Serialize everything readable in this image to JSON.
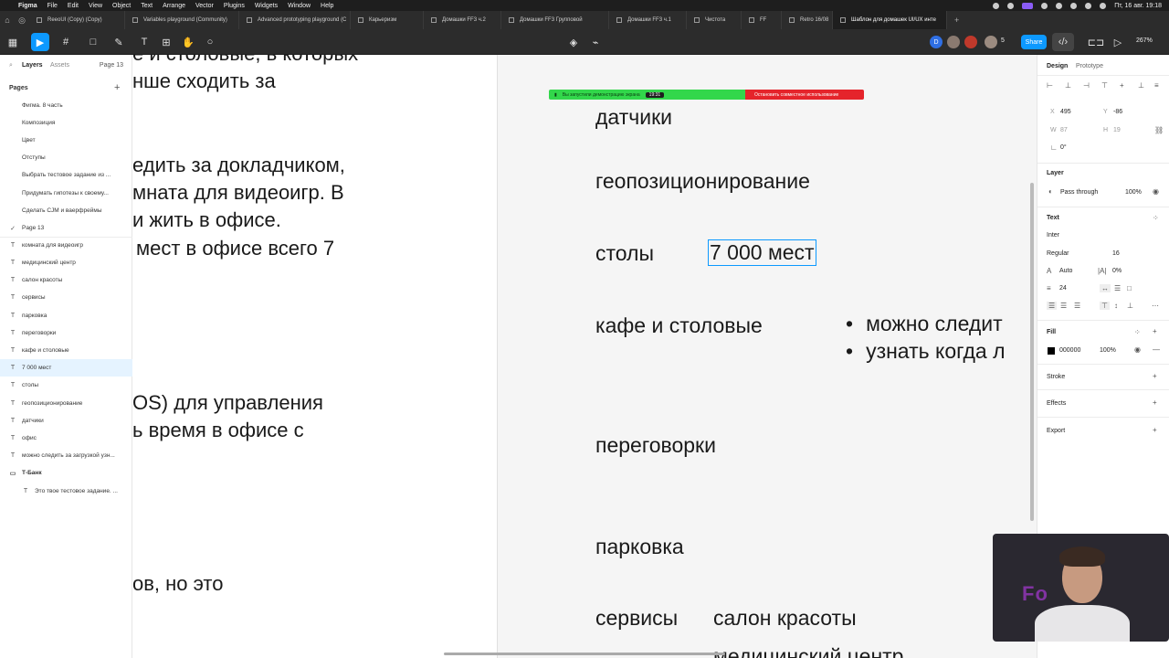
{
  "menubar": {
    "app": "Figma",
    "menus": [
      "File",
      "Edit",
      "View",
      "Object",
      "Text",
      "Arrange",
      "Vector",
      "Plugins",
      "Widgets",
      "Window",
      "Help"
    ],
    "clock": "Пт, 16 авг. 19:18"
  },
  "tabs": [
    {
      "label": "ReeoUI (Copy) (Copy)",
      "active": false
    },
    {
      "label": "Variables playground (Community)",
      "active": false
    },
    {
      "label": "Advanced prototyping playground (C",
      "active": false
    },
    {
      "label": "Карьеризм",
      "active": false
    },
    {
      "label": "Домашки FF3 ч.2",
      "active": false
    },
    {
      "label": "Домашки FF3 Групповой",
      "active": false
    },
    {
      "label": "Домашки FF3 ч.1",
      "active": false
    },
    {
      "label": "Чистота",
      "active": false
    },
    {
      "label": "FF",
      "active": false
    },
    {
      "label": "Retro 16/08",
      "active": false
    },
    {
      "label": "Шаблон для домашек UI/UX инте",
      "active": true
    }
  ],
  "toolbar": {
    "avatar_letter": "D",
    "participants": "5",
    "share_label": "Share",
    "zoom": "267%"
  },
  "left_panel": {
    "tab_layers": "Layers",
    "tab_assets": "Assets",
    "current_page": "Page 13",
    "pages_header": "Pages",
    "pages": [
      "Фигма. 8 часть",
      "Композиция",
      "Цвет",
      "Отступы",
      "Выбрать тестовое задание из ...",
      "Придумать гипотезы к своему...",
      "Сделать CJM и ваерфреймы",
      "Page 13"
    ],
    "layers": [
      "комната для видеоигр",
      "медицинский центр",
      "салон красоты",
      "сервисы",
      "парковка",
      "переговорки",
      "кафе и столовые",
      "7 000 мест",
      "столы",
      "геопозиционирование",
      "датчики",
      "офис",
      "можно следить за загрузкой узн...",
      "Т-Банк",
      "Это твое тестовое задание. ..."
    ]
  },
  "canvas": {
    "left_frame_lines": [
      "е и столовые, в которых",
      "нше сходить за",
      "едить за докладчиком,",
      "мната для видеоигр. В",
      "и жить в офисе.",
      "мест в офисе всего 7",
      "OS) для управления",
      "ь время в офисе с",
      "ов, но это"
    ],
    "right_labels": {
      "datchiki": "датчики",
      "geo": "геопозиционирование",
      "tables": "столы",
      "seats": "7 000 мест",
      "cafe": "кафе и столовые",
      "bullet1": "можно следит",
      "bullet2": "узнать когда л",
      "meetings": "переговорки",
      "parking": "парковка",
      "services": "сервисы",
      "beauty": "салон красоты",
      "medical": "медицинский центр"
    },
    "screen_share": {
      "notice": "Вы запустили демонстрацию экрана",
      "timer": "19:31",
      "stop": "Остановить совместное использование"
    }
  },
  "right_panel": {
    "tab_design": "Design",
    "tab_prototype": "Prototype",
    "x_label": "X",
    "x_value": "495",
    "y_label": "Y",
    "y_value": "-86",
    "w_label": "W",
    "w_value": "87",
    "h_label": "H",
    "h_value": "19",
    "rotation": "0°",
    "layer_header": "Layer",
    "blend": "Pass through",
    "opacity": "100%",
    "text_header": "Text",
    "font": "Inter",
    "weight": "Regular",
    "size": "16",
    "line_height": "Auto",
    "letter_spacing": "0%",
    "paragraph": "24",
    "fill_header": "Fill",
    "fill_hex": "000000",
    "fill_opacity": "100%",
    "stroke_header": "Stroke",
    "effects_header": "Effects",
    "export_header": "Export"
  },
  "webcam": {
    "sign_text": "Fo"
  }
}
